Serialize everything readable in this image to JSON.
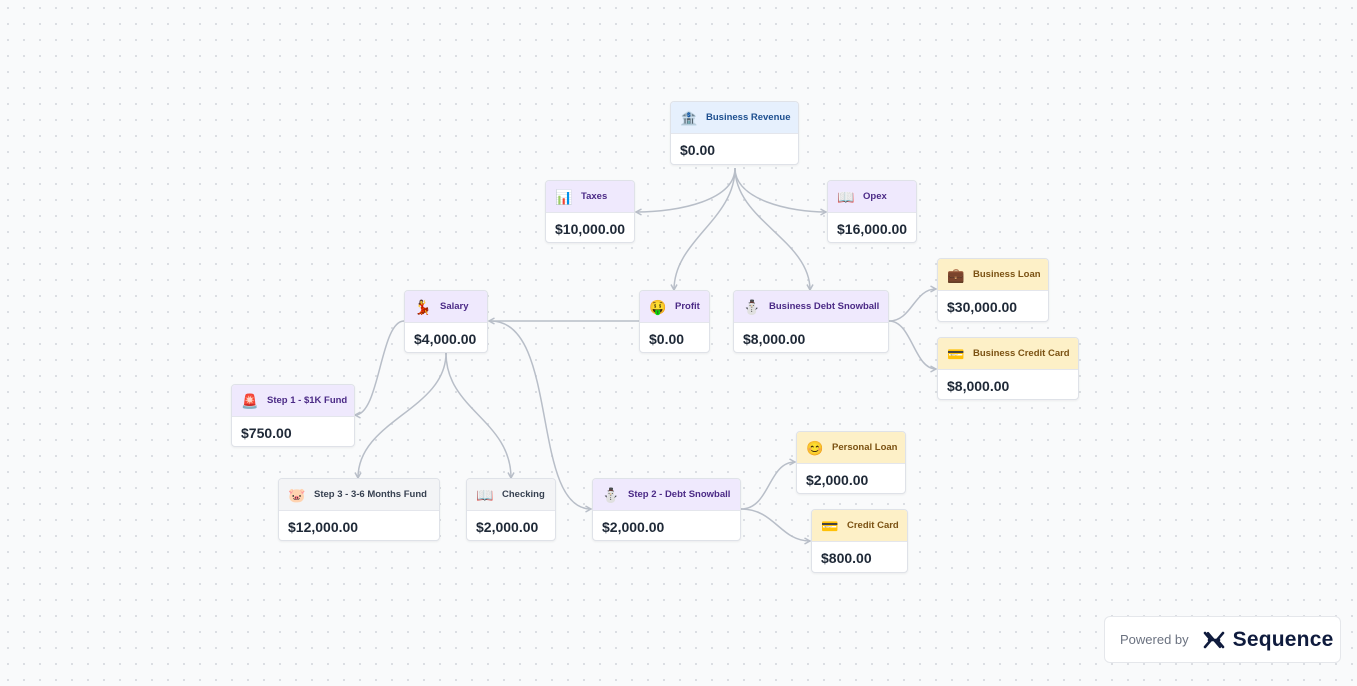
{
  "nodes": {
    "business_revenue": {
      "label": "Business Revenue",
      "amount": "$0.00",
      "icon": "bank-icon",
      "glyph": "🏦"
    },
    "taxes": {
      "label": "Taxes",
      "amount": "$10,000.00",
      "icon": "bar-chart-icon",
      "glyph": "📊"
    },
    "opex": {
      "label": "Opex",
      "amount": "$16,000.00",
      "icon": "open-book-icon",
      "glyph": "📖"
    },
    "salary": {
      "label": "Salary",
      "amount": "$4,000.00",
      "icon": "dancer-icon",
      "glyph": "💃"
    },
    "profit": {
      "label": "Profit",
      "amount": "$0.00",
      "icon": "money-mouth-face-icon",
      "glyph": "🤑"
    },
    "business_debt_snowball": {
      "label": "Business Debt Snowball",
      "amount": "$8,000.00",
      "icon": "snowman-icon",
      "glyph": "⛄"
    },
    "business_loan": {
      "label": "Business Loan",
      "amount": "$30,000.00",
      "icon": "briefcase-icon",
      "glyph": "💼"
    },
    "business_credit_card": {
      "label": "Business Credit Card",
      "amount": "$8,000.00",
      "icon": "credit-card-icon",
      "glyph": "💳"
    },
    "step1": {
      "label": "Step 1 - $1K Fund",
      "amount": "$750.00",
      "icon": "siren-icon",
      "glyph": "🚨"
    },
    "step3": {
      "label": "Step 3 - 3-6 Months Fund",
      "amount": "$12,000.00",
      "icon": "pig-face-icon",
      "glyph": "🐷"
    },
    "checking": {
      "label": "Checking",
      "amount": "$2,000.00",
      "icon": "open-book-icon",
      "glyph": "📖"
    },
    "step2": {
      "label": "Step 2 - Debt Snowball",
      "amount": "$2,000.00",
      "icon": "snowman-icon",
      "glyph": "⛄"
    },
    "personal_loan": {
      "label": "Personal Loan",
      "amount": "$2,000.00",
      "icon": "smiling-face-icon",
      "glyph": "😊"
    },
    "credit_card": {
      "label": "Credit Card",
      "amount": "$800.00",
      "icon": "credit-card-icon",
      "glyph": "💳"
    }
  },
  "footer": {
    "powered_by": "Powered by",
    "brand": "Sequence"
  },
  "colors": {
    "canvas_bg": "#f9fafb",
    "edge": "#b8bec8",
    "header_blue": "#e6f0fd",
    "header_purple": "#efe9fd",
    "header_yellow": "#fdf0c7",
    "header_gray": "#f3f4f6"
  }
}
